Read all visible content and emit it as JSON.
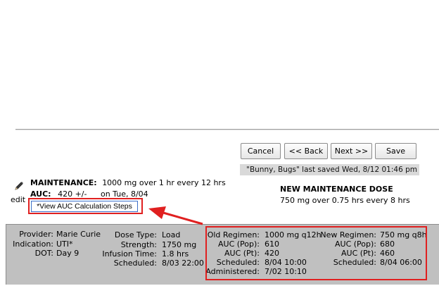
{
  "buttons": {
    "cancel": "Cancel",
    "back": "<< Back",
    "next": "Next >>",
    "save": "Save"
  },
  "saved_status": "\"Bunny, Bugs\" last saved Wed, 8/12 01:46 pm",
  "edit_label": "edit",
  "maintenance": {
    "label": "MAINTENANCE:",
    "value": "1000 mg over 1 hr every 12 hrs"
  },
  "auc": {
    "label": "AUC:",
    "value": "420 +/-",
    "date": "on Tue, 8/04"
  },
  "auc_steps_button": "*View AUC Calculation Steps",
  "new_maintenance": {
    "title": "NEW MAINTENANCE DOSE",
    "value": "750 mg over 0.75 hrs every 8 hrs"
  },
  "info": {
    "provider_label": "Provider:",
    "provider": "Marie Curie",
    "indication_label": "Indication:",
    "indication": "UTI*",
    "dot_label": "DOT:",
    "dot": "Day 9",
    "dose_type_label": "Dose Type:",
    "dose_type": "Load",
    "strength_label": "Strength:",
    "strength": "1750 mg",
    "infusion_label": "Infusion Time:",
    "infusion": "1.8 hrs",
    "scheduled_label": "Scheduled:",
    "scheduled": "8/03 22:00"
  },
  "old_regimen": {
    "regimen_label": "Old Regimen:",
    "regimen": "1000 mg q12h",
    "auc_pop_label": "AUC (Pop):",
    "auc_pop": "610",
    "auc_pt_label": "AUC (Pt):",
    "auc_pt": "420",
    "scheduled_label": "Scheduled:",
    "scheduled": "8/04 10:00",
    "administered_label": "Administered:",
    "administered": "7/02 10:10"
  },
  "new_regimen": {
    "regimen_label": "New Regimen:",
    "regimen": "750 mg q8h",
    "auc_pop_label": "AUC (Pop):",
    "auc_pop": "680",
    "auc_pt_label": "AUC (Pt):",
    "auc_pt": "460",
    "scheduled_label": "Scheduled:",
    "scheduled": "8/04 06:00"
  },
  "colors": {
    "annotation_red": "#e02020",
    "panel_gray": "#c0c0c0",
    "saved_bar_gray": "#d9d9d9"
  },
  "icons": {
    "edit": "pencil-icon"
  }
}
